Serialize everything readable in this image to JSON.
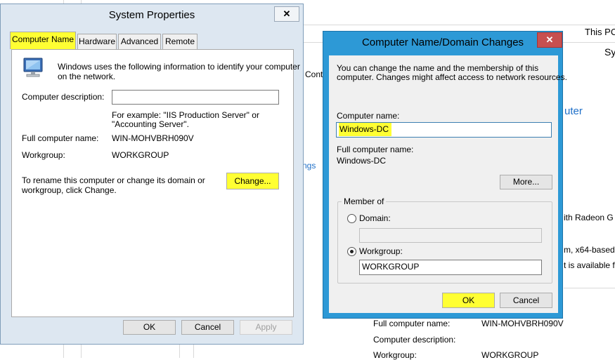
{
  "background": {
    "header_right": "This PC",
    "header_right_2": "Sy",
    "nav_partial": "Cont",
    "link_partial": "ngs",
    "computer_partial": "uter",
    "processor_partial": "ith Radeon G",
    "system_type_partial": "m, x64-based",
    "pen_partial": "t is available f",
    "full_name_label": "Full computer name:",
    "full_name_value": "WIN-MOHVBRH090V",
    "desc_label": "Computer description:",
    "workgroup_label": "Workgroup:",
    "workgroup_value": "WORKGROUP"
  },
  "system_properties": {
    "title": "System Properties",
    "close_glyph": "✕",
    "tabs": [
      "Computer Name",
      "Hardware",
      "Advanced",
      "Remote"
    ],
    "intro": [
      "Windows uses the following information to identify your computer",
      "on the network."
    ],
    "desc_label": "Computer description:",
    "desc_value": "",
    "example": [
      "For example: \"IIS Production Server\" or",
      "\"Accounting Server\"."
    ],
    "full_name_label": "Full computer name:",
    "full_name_value": "WIN-MOHVBRH090V",
    "workgroup_label": "Workgroup:",
    "workgroup_value": "WORKGROUP",
    "rename_text": [
      "To rename this computer or change its domain or",
      "workgroup, click Change."
    ],
    "change_button": "Change...",
    "ok": "OK",
    "cancel": "Cancel",
    "apply": "Apply",
    "highlight_color": "#ffff33"
  },
  "name_changes": {
    "title": "Computer Name/Domain Changes",
    "close_glyph": "✕",
    "intro": [
      "You can change the name and the membership of this",
      "computer. Changes might affect access to network resources."
    ],
    "computer_name_label": "Computer name:",
    "computer_name_value": "Windows-DC",
    "full_name_label": "Full computer name:",
    "full_name_value": "Windows-DC",
    "more_button": "More...",
    "member_of_label": "Member of",
    "domain_label": "Domain:",
    "domain_value": "",
    "workgroup_label": "Workgroup:",
    "workgroup_value": "WORKGROUP",
    "selected_membership": "Workgroup",
    "ok": "OK",
    "cancel": "Cancel",
    "accent_color": "#2d99d6"
  }
}
